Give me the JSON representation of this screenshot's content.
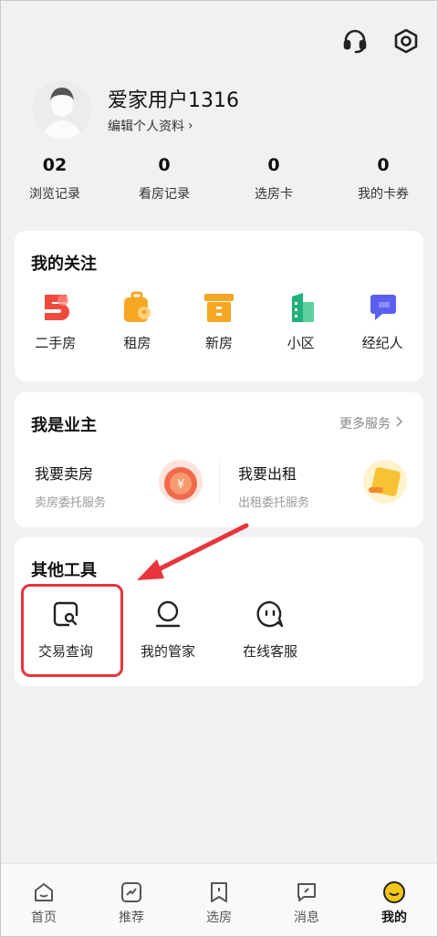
{
  "header": {
    "icons": [
      "headset-icon",
      "settings-hex-icon"
    ]
  },
  "profile": {
    "name": "爱家用户1316",
    "edit_label": "编辑个人资料",
    "chevron": "›"
  },
  "stats": [
    {
      "value": "02",
      "label": "浏览记录"
    },
    {
      "value": "0",
      "label": "看房记录"
    },
    {
      "value": "0",
      "label": "选房卡"
    },
    {
      "value": "0",
      "label": "我的卡券"
    }
  ],
  "follow": {
    "title": "我的关注",
    "items": [
      {
        "label": "二手房",
        "icon": "second-hand-house-icon",
        "color": "#f04a3f"
      },
      {
        "label": "租房",
        "icon": "rent-icon",
        "color": "#f5a623"
      },
      {
        "label": "新房",
        "icon": "new-house-icon",
        "color": "#f5a623"
      },
      {
        "label": "小区",
        "icon": "community-icon",
        "color": "#21b27a"
      },
      {
        "label": "经纪人",
        "icon": "agent-icon",
        "color": "#5b5ff0"
      }
    ]
  },
  "owner": {
    "title": "我是业主",
    "more_label": "更多服务",
    "sell": {
      "title": "我要卖房",
      "subtitle": "卖房委托服务"
    },
    "rent": {
      "title": "我要出租",
      "subtitle": "出租委托服务"
    }
  },
  "tools": {
    "title": "其他工具",
    "items": [
      {
        "label": "交易查询",
        "icon": "transaction-search-icon"
      },
      {
        "label": "我的管家",
        "icon": "butler-icon"
      },
      {
        "label": "在线客服",
        "icon": "chat-service-icon"
      }
    ]
  },
  "tabbar": [
    {
      "label": "首页",
      "icon": "home-icon",
      "active": false
    },
    {
      "label": "推荐",
      "icon": "recommend-icon",
      "active": false
    },
    {
      "label": "选房",
      "icon": "bookmark-icon",
      "active": false
    },
    {
      "label": "消息",
      "icon": "message-icon",
      "active": false
    },
    {
      "label": "我的",
      "icon": "me-icon",
      "active": true
    }
  ],
  "colors": {
    "accent": "#f5c518",
    "highlight": "#e8343d",
    "background": "#f1f1f3"
  }
}
